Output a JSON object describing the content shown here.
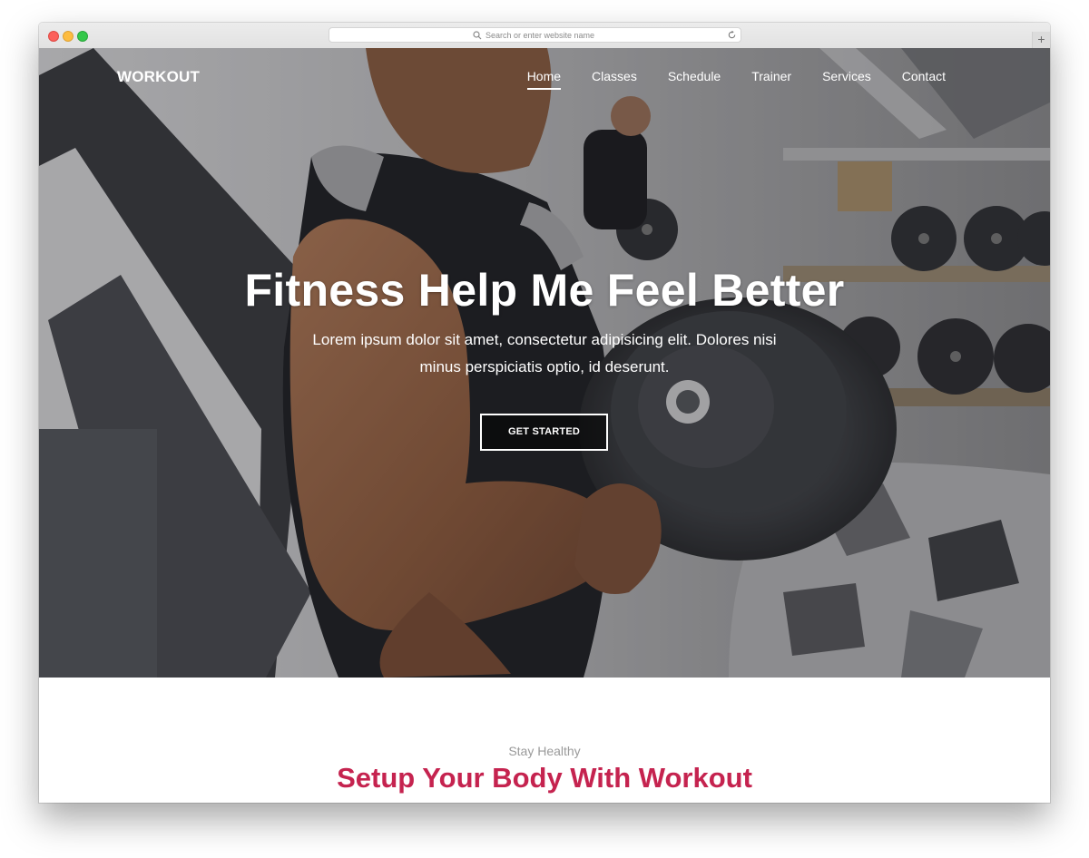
{
  "browser": {
    "url_placeholder": "Search or enter website name",
    "new_tab_label": "+"
  },
  "header": {
    "logo": "WORKOUT",
    "nav": [
      {
        "label": "Home",
        "active": true
      },
      {
        "label": "Classes",
        "active": false
      },
      {
        "label": "Schedule",
        "active": false
      },
      {
        "label": "Trainer",
        "active": false
      },
      {
        "label": "Services",
        "active": false
      },
      {
        "label": "Contact",
        "active": false
      }
    ]
  },
  "hero": {
    "title": "Fitness Help Me Feel Better",
    "subtitle": "Lorem ipsum dolor sit amet, consectetur adipisicing elit. Dolores nisi minus perspiciatis optio, id deserunt.",
    "cta_label": "GET STARTED"
  },
  "section": {
    "eyebrow": "Stay Healthy",
    "title": "Setup Your Body With Workout"
  },
  "colors": {
    "accent": "#c5234f",
    "nav_text": "#ffffff"
  }
}
